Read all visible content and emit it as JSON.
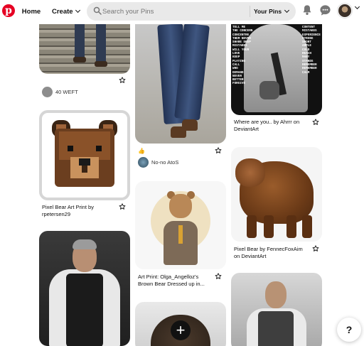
{
  "header": {
    "home_label": "Home",
    "create_label": "Create",
    "search_placeholder": "Search your Pins",
    "search_scope_label": "Your Pins"
  },
  "pins": {
    "col1": [
      {
        "credit": "40 WEFT"
      },
      {
        "title": "Pixel Bear Art Print by rpetersen29"
      }
    ],
    "col2": [
      {
        "reaction": "👍",
        "credit": "No-no AtoS"
      },
      {
        "title": "Art Print: Olga_Angelloz's Brown Bear Dressed up in..."
      }
    ],
    "col3": [
      {
        "title": "Where are you.. by Ahrrr on DeviantArt"
      },
      {
        "title": "Pixel Bear by FennecFoxAim on DeviantArt"
      }
    ]
  },
  "comic_text": "TELL ME\nTHE CONCERN\nCONCENTRE\nTHEM NEVER\nSHARE DEEP\nMISTAKES\nWILL YOUR\nLOVE\nKEEP\nPLAYING\nCALL\nWHO\nDEMAND\nNEVER\nBETTER\nFORGIVE",
  "comic_text_right": "CONTENT\nMISTAKES\nEXPERIENCE\nSTRONG\nSPORT\nAMPLE\nCOLD\nREACH\nMANY\nSTANDS\nREMEMBER\nREMEMBER\nCALM",
  "floating": {
    "plus": "+",
    "help": "?"
  },
  "colors": {
    "brand": "#e60023",
    "search_bg": "#e9e9e9"
  },
  "icons": [
    "pinterest-logo",
    "search-icon",
    "bell-icon",
    "chat-icon",
    "more-icon",
    "plus-icon",
    "help-icon"
  ]
}
